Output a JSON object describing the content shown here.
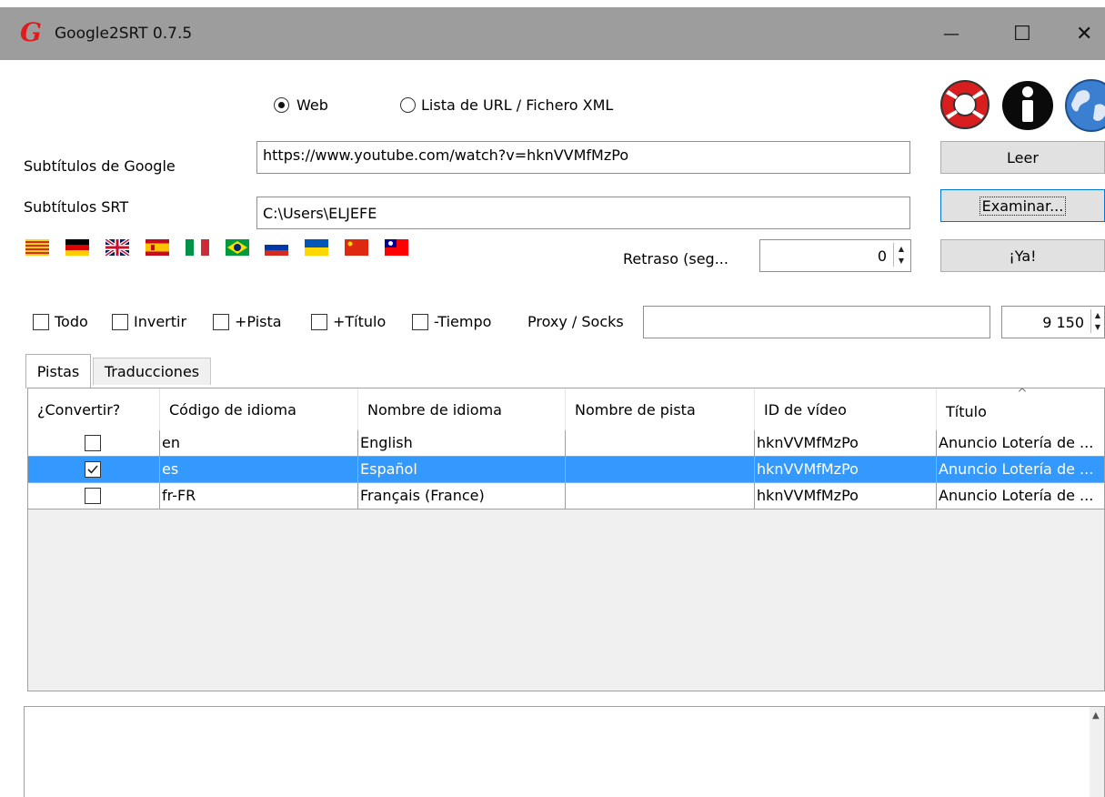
{
  "window": {
    "title": "Google2SRT 0.7.5",
    "logo_letter": "G",
    "minimize": "—",
    "maximize": "☐",
    "close": "✕"
  },
  "source": {
    "radio_web": "Web",
    "radio_list": "Lista de URL / Fichero XML",
    "selected": "Web"
  },
  "fields": {
    "google_label": "Subtítulos de Google",
    "google_value": "https://www.youtube.com/watch?v=hknVVMfMzPo",
    "srt_label": "Subtítulos SRT",
    "srt_value": "C:\\Users\\ELJEFE",
    "delay_label": "Retraso (seg...",
    "delay_value": "0"
  },
  "buttons": {
    "read": "Leer",
    "browse": "Examinar...",
    "go": "¡Ya!"
  },
  "flags": [
    "catalan",
    "german",
    "english-uk",
    "spanish",
    "italian",
    "portuguese-brazil",
    "russian",
    "ukrainian",
    "chinese",
    "taiwan"
  ],
  "options": {
    "all": "Todo",
    "invert": "Invertir",
    "track": "+Pista",
    "title": "+Título",
    "time": "-Tiempo",
    "proxy_label": "Proxy / Socks",
    "proxy_value": "",
    "port_value": "9 150"
  },
  "tabs": [
    "Pistas",
    "Traducciones"
  ],
  "table": {
    "columns": [
      "¿Convertir?",
      "Código de idioma",
      "Nombre de idioma",
      "Nombre de pista",
      "ID de vídeo",
      "Título"
    ],
    "sort_indicator": "^",
    "rows": [
      {
        "convert": false,
        "code": "en",
        "language": "English",
        "track": "",
        "video_id": "hknVVMfMzPo",
        "title": "Anuncio Lotería de ...",
        "selected": false
      },
      {
        "convert": true,
        "code": "es",
        "language": "Español",
        "track": "",
        "video_id": "hknVVMfMzPo",
        "title": "Anuncio Lotería de ...",
        "selected": true
      },
      {
        "convert": false,
        "code": "fr-FR",
        "language": "Français (France)",
        "track": "",
        "video_id": "hknVVMfMzPo",
        "title": "Anuncio Lotería de ...",
        "selected": false
      }
    ]
  },
  "colors": {
    "titlebar": "#9d9d9d",
    "selection": "#3399ff",
    "logo": "#e01b1b"
  },
  "icons": [
    "lifebuoy-icon",
    "info-icon",
    "globe-icon"
  ]
}
